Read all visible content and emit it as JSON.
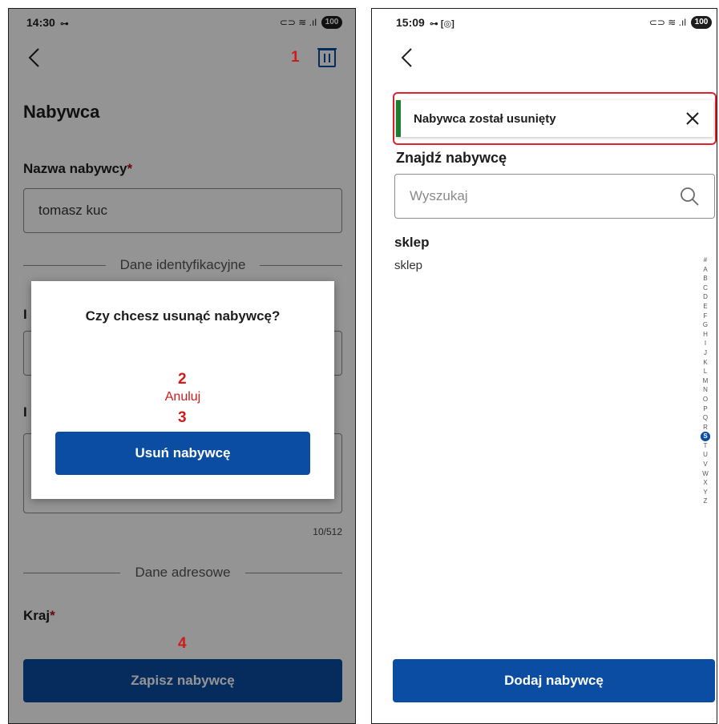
{
  "left_screen": {
    "status_bar": {
      "time": "14:30",
      "time_extra": "⊶",
      "system_icons": "⊂⊃ ≋ .ıl",
      "battery": "100"
    },
    "page_title": "Nabywca",
    "name_field": {
      "label": "Nazwa nabywcy",
      "required_mark": "*",
      "value": "tomasz kuc"
    },
    "identification_section": "Dane identyfikacyjne",
    "hidden_label_1": "I",
    "hidden_label_2": "I",
    "char_counter": "10/512",
    "address_section": "Dane adresowe",
    "country_field": {
      "label": "Kraj",
      "required_mark": "*"
    },
    "save_button": "Zapisz nabywcę",
    "dialog": {
      "title": "Czy chcesz usunąć nabywcę?",
      "cancel_label": "Anuluj",
      "delete_button": "Usuń nabywcę"
    },
    "annotations": {
      "a1": "1",
      "a2": "2",
      "a3": "3",
      "a4": "4"
    },
    "colors": {
      "primary": "#0b4da2",
      "annotation": "#d11a1a",
      "overlay": "rgba(0,0,0,0.42)"
    }
  },
  "right_screen": {
    "status_bar": {
      "time": "15:09",
      "time_extra": "⊶ [◎]",
      "system_icons": "⊂⊃ ≋ .ıl",
      "battery": "100"
    },
    "toast": {
      "message": "Nabywca został usunięty"
    },
    "find_title": "Znajdź nabywcę",
    "search": {
      "placeholder": "Wyszukaj",
      "value": ""
    },
    "list": {
      "group_header": "sklep",
      "items": [
        "sklep"
      ]
    },
    "alphabet_index": {
      "letters": [
        "#",
        "A",
        "B",
        "C",
        "D",
        "E",
        "F",
        "G",
        "H",
        "I",
        "J",
        "K",
        "L",
        "M",
        "N",
        "O",
        "P",
        "Q",
        "R",
        "S",
        "T",
        "U",
        "V",
        "W",
        "X",
        "Y",
        "Z"
      ],
      "active": "S"
    },
    "add_button": "Dodaj nabywcę",
    "colors": {
      "primary": "#0b4da2",
      "toast_border": "#e0202a",
      "toast_accent": "#1e7d2f"
    }
  }
}
